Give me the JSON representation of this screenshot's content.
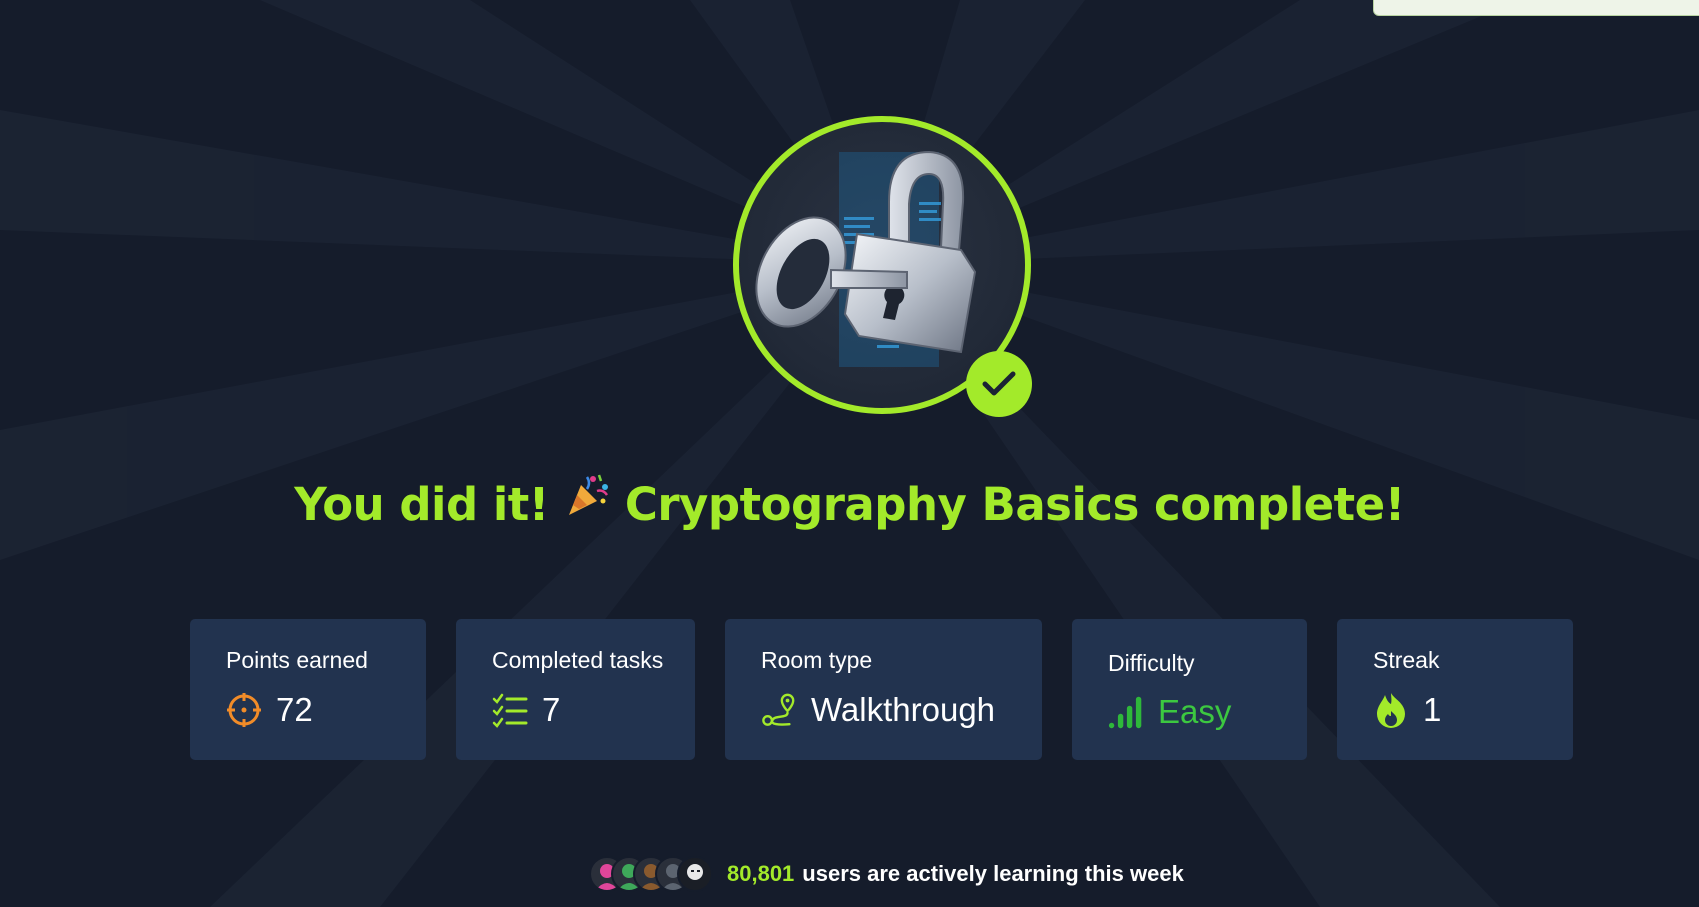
{
  "page": {
    "background": "#151c2b",
    "accent": "#a3ea2a"
  },
  "badge": {
    "icon": "lock-and-key-icon",
    "status_icon": "checkmark-icon"
  },
  "headline": {
    "prefix": "You did it!",
    "emoji_icon": "party-popper-icon",
    "suffix": "Cryptography Basics complete!"
  },
  "stats": [
    {
      "label": "Points earned",
      "value": "72",
      "icon": "target-icon",
      "icon_color": "#f28c28",
      "value_color": "#ffffff"
    },
    {
      "label": "Completed tasks",
      "value": "7",
      "icon": "checklist-icon",
      "icon_color": "#a3ea2a",
      "value_color": "#ffffff"
    },
    {
      "label": "Room type",
      "value": "Walkthrough",
      "icon": "route-icon",
      "icon_color": "#a3ea2a",
      "value_color": "#ffffff"
    },
    {
      "label": "Difficulty",
      "value": "Easy",
      "icon": "signal-bars-icon",
      "icon_color": "#2eb83a",
      "value_color": "#3cc840"
    },
    {
      "label": "Streak",
      "value": "1",
      "icon": "flame-icon",
      "icon_color": "#a3ea2a",
      "value_color": "#ffffff"
    }
  ],
  "footer": {
    "count": "80,801",
    "text": "users are actively learning this week",
    "avatar_colors": [
      "#e0469a",
      "#3ea85a",
      "#8a5a2e",
      "#5c6470",
      "#e8e8e8"
    ]
  }
}
